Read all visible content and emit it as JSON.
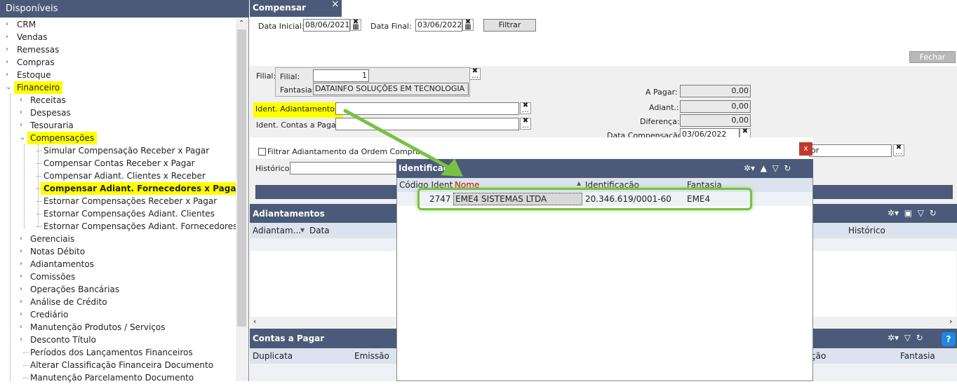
{
  "left_panel": {
    "title": "Disponíveis",
    "tree": [
      {
        "label": "CRM",
        "level": 0,
        "expanded": false,
        "highlight": false
      },
      {
        "label": "Vendas",
        "level": 0,
        "expanded": false,
        "highlight": false
      },
      {
        "label": "Remessas",
        "level": 0,
        "expanded": false,
        "highlight": false
      },
      {
        "label": "Compras",
        "level": 0,
        "expanded": false,
        "highlight": false
      },
      {
        "label": "Estoque",
        "level": 0,
        "expanded": false,
        "highlight": false
      },
      {
        "label": "Financeiro",
        "level": 0,
        "expanded": true,
        "highlight": true
      },
      {
        "label": "Receitas",
        "level": 1,
        "expanded": false,
        "highlight": false
      },
      {
        "label": "Despesas",
        "level": 1,
        "expanded": false,
        "highlight": false
      },
      {
        "label": "Tesouraria",
        "level": 1,
        "expanded": false,
        "highlight": false
      },
      {
        "label": "Compensações",
        "level": 1,
        "expanded": true,
        "highlight": true
      },
      {
        "label": "Simular Compensação Receber x Pagar",
        "level": 2,
        "highlight": false
      },
      {
        "label": "Compensar Contas Receber x Pagar",
        "level": 2,
        "highlight": false
      },
      {
        "label": "Compensar Adiant. Clientes x Receber",
        "level": 2,
        "highlight": false
      },
      {
        "label": "Compensar Adiant. Fornecedores x Pagar",
        "level": 2,
        "highlight": true,
        "bold": true
      },
      {
        "label": "Estornar Compensações Receber x Pagar",
        "level": 2,
        "highlight": false
      },
      {
        "label": "Estornar Compensações Adiant. Clientes",
        "level": 2,
        "highlight": false
      },
      {
        "label": "Estornar Compensações Adiant. Fornecedores",
        "level": 2,
        "highlight": false
      },
      {
        "label": "Gerenciais",
        "level": 1,
        "expanded": false,
        "highlight": false
      },
      {
        "label": "Notas Débito",
        "level": 1,
        "expanded": false,
        "highlight": false
      },
      {
        "label": "Adiantamentos",
        "level": 1,
        "expanded": false,
        "highlight": false
      },
      {
        "label": "Comissões",
        "level": 1,
        "expanded": false,
        "highlight": false
      },
      {
        "label": "Operações Bancárias",
        "level": 1,
        "expanded": false,
        "highlight": false
      },
      {
        "label": "Análise de Crédito",
        "level": 1,
        "expanded": false,
        "highlight": false
      },
      {
        "label": "Crediário",
        "level": 1,
        "expanded": false,
        "highlight": false
      },
      {
        "label": "Manutenção Produtos / Serviços",
        "level": 1,
        "expanded": false,
        "highlight": false
      },
      {
        "label": "Desconto Título",
        "level": 1,
        "expanded": false,
        "highlight": false
      },
      {
        "label": "Períodos dos Lançamentos Financeiros",
        "level": 1,
        "leaf": true,
        "highlight": false
      },
      {
        "label": "Alterar Classificação Financeira Documento",
        "level": 1,
        "leaf": true,
        "highlight": false
      },
      {
        "label": "Manutenção Parcelamento Documento",
        "level": 1,
        "leaf": true,
        "highlight": false
      }
    ]
  },
  "tab": {
    "title": "Compensar Adiant...",
    "close": "×"
  },
  "filters": {
    "data_inicial_label": "Data Inicial:",
    "data_inicial": "08/06/2021",
    "data_final_label": "Data Final:",
    "data_final": "03/06/2022",
    "filtrar": "Filtrar",
    "fechar": "Fechar"
  },
  "filial": {
    "outer_label": "Filial:",
    "filial_label": "Filial:",
    "filial_value": "1",
    "fantasia_label": "Fantasia:",
    "fantasia_value": "DATAINFO SOLUÇÕES EM TECNOLOGIA DA II"
  },
  "ident": {
    "adiant_label": "Ident. Adiantamentos:",
    "contas_label": "Ident. Contas a Pagar:",
    "filtrar_ordem": "Filtrar Adiantamento da Ordem Compra",
    "historico_label": "Histórico:",
    "partial_right": "or"
  },
  "totals": {
    "a_pagar_label": "A Pagar:",
    "a_pagar": "0,00",
    "adiant_label": "Adiant.:",
    "adiant": "0,00",
    "diferenca_label": "Diferença:",
    "diferenca": "0,00",
    "data_comp_label": "Data Compensação:",
    "data_comp": "03/06/2022"
  },
  "adiantamentos": {
    "title": "Adiantamentos",
    "columns": [
      "Adiantam...",
      "Data",
      "Histórico"
    ]
  },
  "contas_pagar": {
    "title": "Contas a Pagar",
    "columns": [
      "Duplicata",
      "Emissão",
      "ção",
      "Fantasia"
    ]
  },
  "popup": {
    "title": "Identificaç",
    "columns": [
      "Código Ident",
      "Nome",
      "Identificação",
      "Fantasia"
    ],
    "rows": [
      {
        "codigo": "2747",
        "nome": "EME4 SISTEMAS LTDA",
        "identificacao": "20.346.619/0001-60",
        "fantasia": "EME4"
      }
    ],
    "close": "x"
  },
  "colors": {
    "header": "#4a5a78",
    "highlight": "#ffff00",
    "annotation": "#7ac143",
    "nome_col": "#cc0000"
  }
}
